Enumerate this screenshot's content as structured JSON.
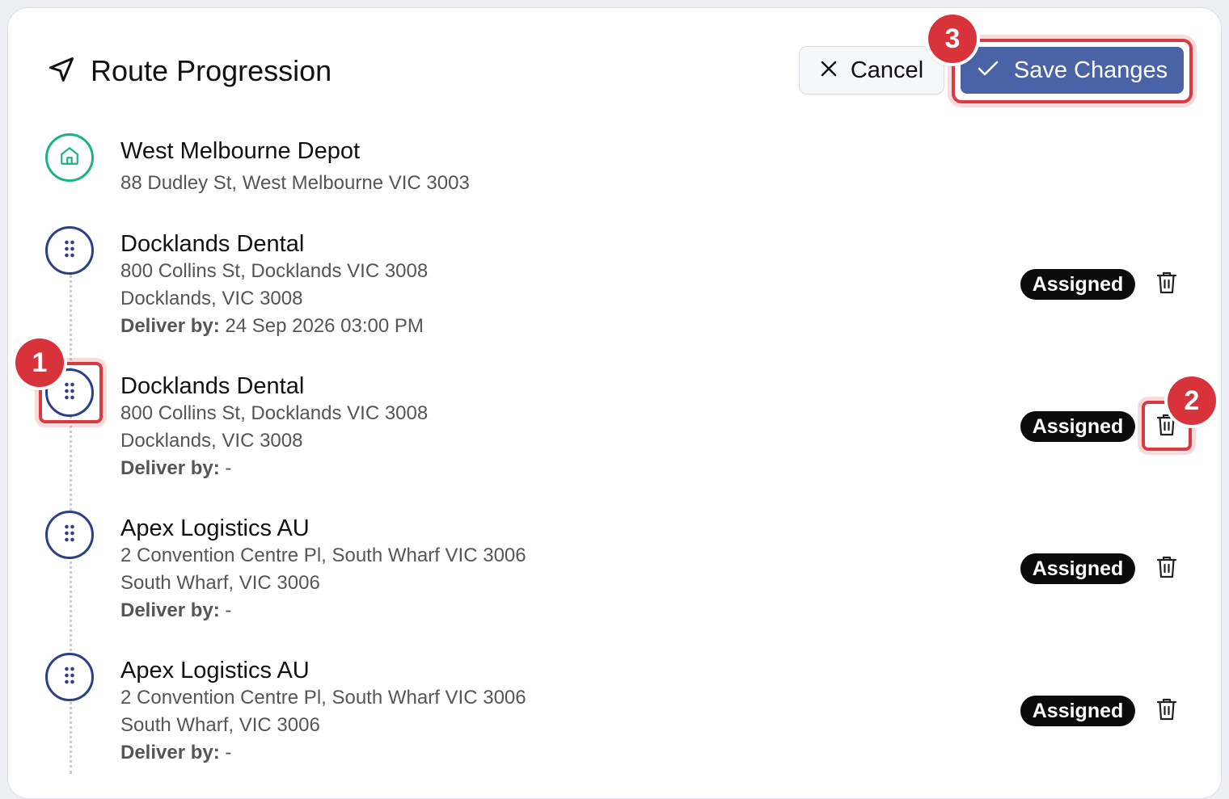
{
  "header": {
    "title": "Route Progression",
    "icon": "navigation-arrow-icon",
    "cancel_label": "Cancel",
    "save_label": "Save Changes"
  },
  "markers": [
    "1",
    "2",
    "3"
  ],
  "depot": {
    "name": "West Melbourne Depot",
    "address": "88 Dudley St, West Melbourne VIC 3003",
    "icon": "home-icon"
  },
  "stops": [
    {
      "name": "Docklands Dental",
      "address": "800 Collins St, Docklands VIC 3008",
      "locality": "Docklands, VIC 3008",
      "deliver_label": "Deliver by:",
      "deliver_value": " 24 Sep 2026 03:00 PM",
      "status": "Assigned"
    },
    {
      "name": "Docklands Dental",
      "address": "800 Collins St, Docklands VIC 3008",
      "locality": "Docklands, VIC 3008",
      "deliver_label": "Deliver by:",
      "deliver_value": " -",
      "status": "Assigned"
    },
    {
      "name": "Apex Logistics AU",
      "address": "2 Convention Centre Pl, South Wharf VIC 3006",
      "locality": "South Wharf, VIC 3006",
      "deliver_label": "Deliver by:",
      "deliver_value": " -",
      "status": "Assigned"
    },
    {
      "name": "Apex Logistics AU",
      "address": "2 Convention Centre Pl, South Wharf VIC 3006",
      "locality": "South Wharf, VIC 3006",
      "deliver_label": "Deliver by:",
      "deliver_value": " -",
      "status": "Assigned"
    }
  ],
  "colors": {
    "primary": "#4a62a6",
    "depot_accent": "#19b485",
    "stop_accent": "#2c3f8a",
    "highlight": "#d93a3f",
    "badge_bg": "#0b0b0b"
  }
}
